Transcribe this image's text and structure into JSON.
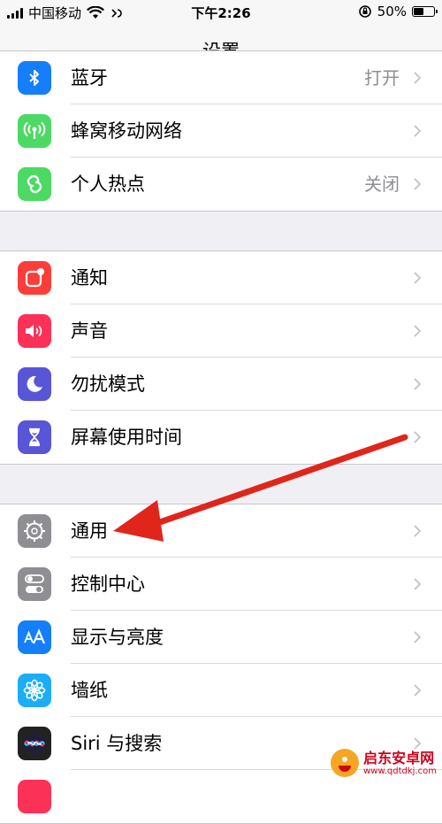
{
  "status_bar": {
    "carrier": "中国移动",
    "time": "下午2:26",
    "battery": "50%",
    "battery_level": 0.5
  },
  "nav": {
    "title": "设置"
  },
  "groups": [
    {
      "items": [
        {
          "label": "蓝牙",
          "value": "打开",
          "icon": "bluetooth-icon",
          "color": "#157efb"
        },
        {
          "label": "蜂窝移动网络",
          "value": "",
          "icon": "cellular-antenna-icon",
          "color": "#4cd964"
        },
        {
          "label": "个人热点",
          "value": "关闭",
          "icon": "hotspot-link-icon",
          "color": "#4cd964"
        }
      ]
    },
    {
      "items": [
        {
          "label": "通知",
          "icon": "notifications-icon",
          "color": "#fc3d39"
        },
        {
          "label": "声音",
          "icon": "speaker-icon",
          "color": "#fc3158"
        },
        {
          "label": "勿扰模式",
          "icon": "moon-icon",
          "color": "#5856d6"
        },
        {
          "label": "屏幕使用时间",
          "icon": "hourglass-icon",
          "color": "#5856d6"
        }
      ]
    },
    {
      "items": [
        {
          "label": "通用",
          "icon": "gear-icon",
          "color": "#8e8e93"
        },
        {
          "label": "控制中心",
          "icon": "toggles-icon",
          "color": "#8e8e93"
        },
        {
          "label": "显示与亮度",
          "icon": "text-size-icon",
          "color": "#157efb"
        },
        {
          "label": "墙纸",
          "icon": "flower-icon",
          "color": "#1badf8"
        },
        {
          "label": "Siri 与搜索",
          "icon": "siri-icon",
          "color": "#222222"
        }
      ]
    }
  ],
  "watermark": {
    "text": "启东安卓网",
    "url": "www.qdtdkj.com"
  }
}
